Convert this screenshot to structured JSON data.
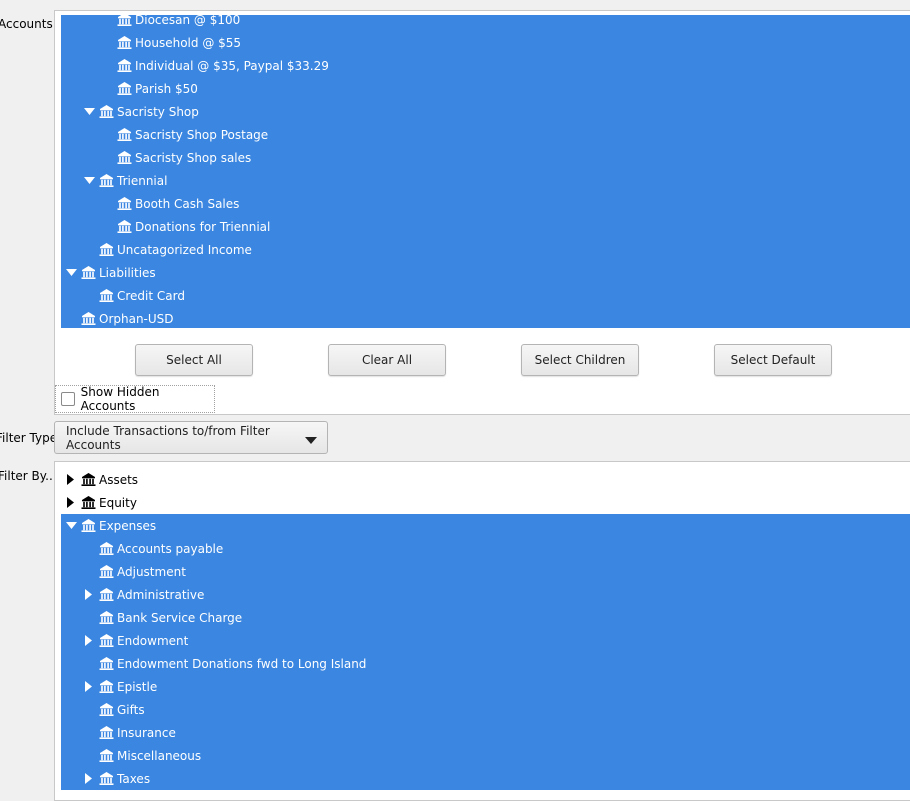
{
  "labels": {
    "accounts": "Accounts",
    "filter_type": "Filter Type",
    "filter_by": "Filter By..."
  },
  "accounts_tree": {
    "rows": [
      {
        "label": "Diocesan @ $100",
        "depth": 2,
        "expander": "none",
        "selected": true
      },
      {
        "label": "Household @ $55",
        "depth": 2,
        "expander": "none",
        "selected": true
      },
      {
        "label": "Individual @ $35, Paypal $33.29",
        "depth": 2,
        "expander": "none",
        "selected": true
      },
      {
        "label": "Parish $50",
        "depth": 2,
        "expander": "none",
        "selected": true
      },
      {
        "label": "Sacristy Shop",
        "depth": 1,
        "expander": "expanded",
        "selected": true
      },
      {
        "label": "Sacristy Shop Postage",
        "depth": 2,
        "expander": "none",
        "selected": true
      },
      {
        "label": "Sacristy Shop sales",
        "depth": 2,
        "expander": "none",
        "selected": true
      },
      {
        "label": "Triennial",
        "depth": 1,
        "expander": "expanded",
        "selected": true
      },
      {
        "label": "Booth Cash Sales",
        "depth": 2,
        "expander": "none",
        "selected": true
      },
      {
        "label": "Donations for Triennial",
        "depth": 2,
        "expander": "none",
        "selected": true
      },
      {
        "label": "Uncatagorized Income",
        "depth": 1,
        "expander": "none",
        "selected": true
      },
      {
        "label": "Liabilities",
        "depth": 0,
        "expander": "expanded",
        "selected": true
      },
      {
        "label": "Credit Card",
        "depth": 1,
        "expander": "none",
        "selected": true
      },
      {
        "label": "Orphan-USD",
        "depth": 0,
        "expander": "none",
        "selected": true
      }
    ]
  },
  "buttons": {
    "select_all": "Select All",
    "clear_all": "Clear All",
    "select_children": "Select Children",
    "select_default": "Select Default"
  },
  "show_hidden": {
    "label": "Show Hidden Accounts",
    "checked": false
  },
  "filter_type": {
    "selected": "Include Transactions to/from Filter Accounts"
  },
  "filter_tree": {
    "rows": [
      {
        "label": "Assets",
        "depth": 0,
        "expander": "collapsed",
        "selected": false
      },
      {
        "label": "Equity",
        "depth": 0,
        "expander": "collapsed",
        "selected": false
      },
      {
        "label": "Expenses",
        "depth": 0,
        "expander": "expanded",
        "selected": true
      },
      {
        "label": "Accounts payable",
        "depth": 1,
        "expander": "none",
        "selected": true
      },
      {
        "label": "Adjustment",
        "depth": 1,
        "expander": "none",
        "selected": true
      },
      {
        "label": "Administrative",
        "depth": 1,
        "expander": "collapsed",
        "selected": true
      },
      {
        "label": "Bank Service Charge",
        "depth": 1,
        "expander": "none",
        "selected": true
      },
      {
        "label": "Endowment",
        "depth": 1,
        "expander": "collapsed",
        "selected": true
      },
      {
        "label": "Endowment Donations fwd to Long Island",
        "depth": 1,
        "expander": "none",
        "selected": true
      },
      {
        "label": "Epistle",
        "depth": 1,
        "expander": "collapsed",
        "selected": true
      },
      {
        "label": "Gifts",
        "depth": 1,
        "expander": "none",
        "selected": true
      },
      {
        "label": "Insurance",
        "depth": 1,
        "expander": "none",
        "selected": true
      },
      {
        "label": "Miscellaneous",
        "depth": 1,
        "expander": "none",
        "selected": true
      },
      {
        "label": "Taxes",
        "depth": 1,
        "expander": "collapsed",
        "selected": true
      }
    ]
  },
  "colors": {
    "selection": "#3a86e0",
    "selection_text": "#ffffff"
  },
  "icons": {
    "account": "bank-building-icon",
    "expanded": "triangle-down-icon",
    "collapsed": "triangle-right-icon"
  }
}
